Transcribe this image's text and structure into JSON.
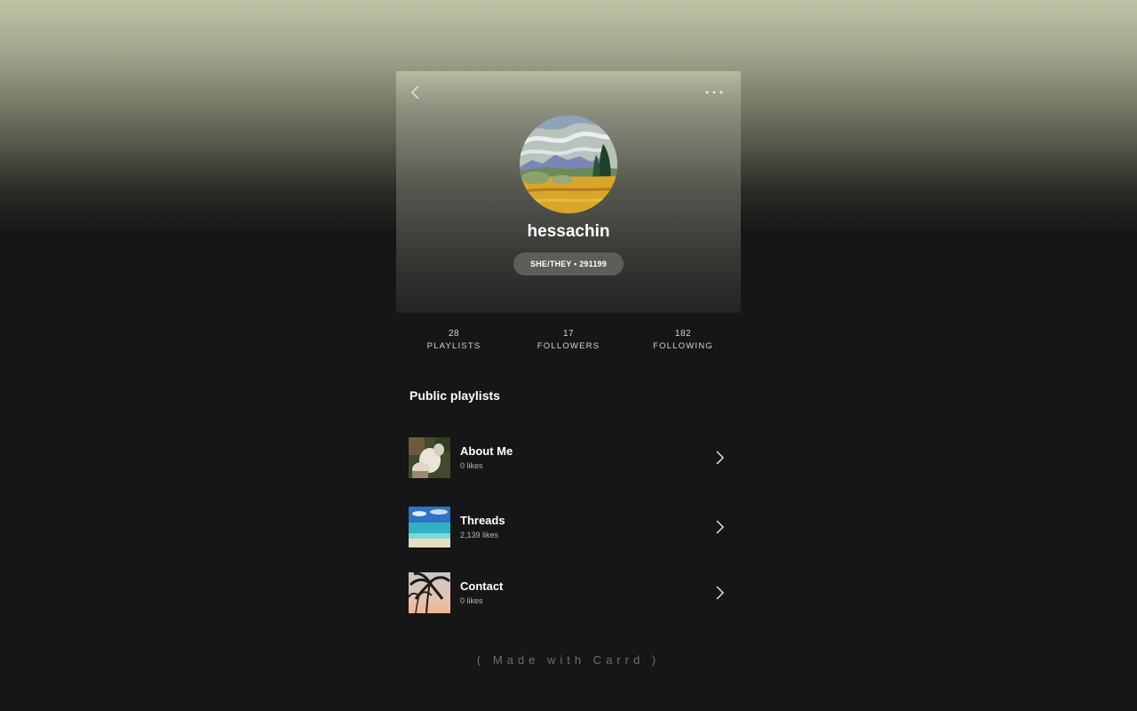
{
  "profile": {
    "username": "hessachin",
    "badge": "SHE/THEY • 291199"
  },
  "stats": [
    {
      "value": "28",
      "label": "PLAYLISTS"
    },
    {
      "value": "17",
      "label": "FOLLOWERS"
    },
    {
      "value": "182",
      "label": "FOLLOWING"
    }
  ],
  "section": {
    "title": "Public playlists"
  },
  "playlists": [
    {
      "name": "About Me",
      "likes": "0 likes"
    },
    {
      "name": "Threads",
      "likes": "2,139 likes"
    },
    {
      "name": "Contact",
      "likes": "0 likes"
    }
  ],
  "footer": {
    "text": "( Made with Carrd )"
  },
  "icons": {
    "back": "chevron-left-icon",
    "more": "more-horizontal-icon",
    "row_arrow": "chevron-right-icon"
  },
  "colors": {
    "background": "#161616",
    "header_top": "#bfc4a7",
    "badge_bg": "#5d5e5a",
    "text_primary": "#ffffff",
    "text_secondary": "#b5b5b5",
    "footer_text": "#6f6f6f"
  }
}
